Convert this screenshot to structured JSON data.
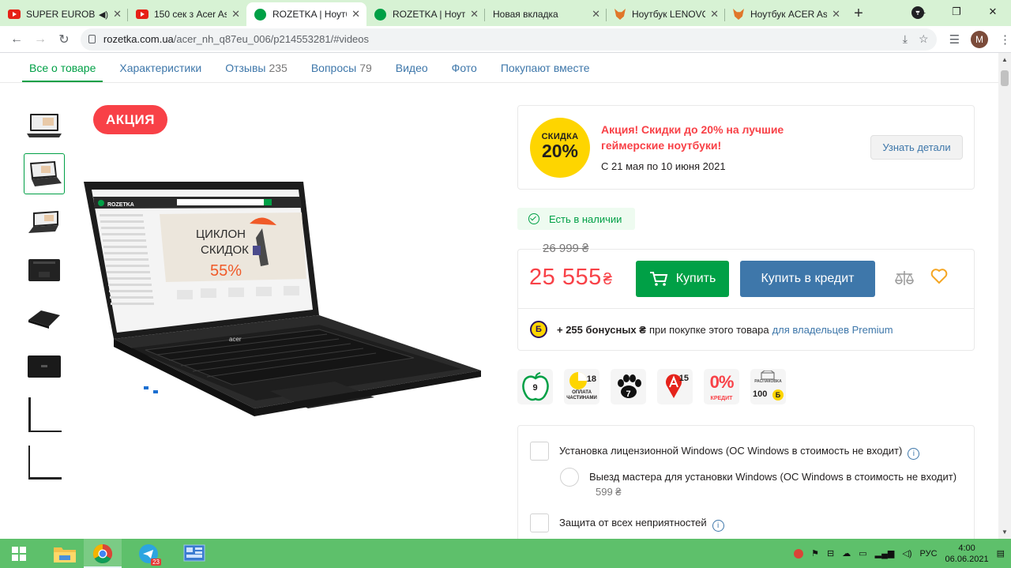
{
  "browser": {
    "tabs": [
      {
        "title": "SUPER EUROB",
        "favicon": "youtube-icon",
        "audio": true,
        "active": false
      },
      {
        "title": "150 сек з Acer Asp",
        "favicon": "youtube-icon",
        "audio": false,
        "active": false
      },
      {
        "title": "ROZETKA | Ноутбу",
        "favicon": "rozetka-icon",
        "audio": false,
        "active": true
      },
      {
        "title": "ROZETKA | Ноутбу",
        "favicon": "rozetka-icon",
        "audio": false,
        "active": false
      },
      {
        "title": "Новая вкладка",
        "favicon": "none",
        "audio": false,
        "active": false
      },
      {
        "title": "Ноутбук LENOVO",
        "favicon": "fox-icon",
        "audio": false,
        "active": false
      },
      {
        "title": "Ноутбук ACER As",
        "favicon": "fox-icon",
        "audio": false,
        "active": false
      }
    ],
    "url_host": "rozetka.com.ua",
    "url_path": "/acer_nh_q87eu_006/p214553281/#videos",
    "profile_initial": "M"
  },
  "product_tabs": [
    {
      "label": "Все о товаре",
      "count": "",
      "active": true
    },
    {
      "label": "Характеристики",
      "count": "",
      "active": false
    },
    {
      "label": "Отзывы",
      "count": "235",
      "active": false
    },
    {
      "label": "Вопросы",
      "count": "79",
      "active": false
    },
    {
      "label": "Видео",
      "count": "",
      "active": false
    },
    {
      "label": "Фото",
      "count": "",
      "active": false
    },
    {
      "label": "Покупают вместе",
      "count": "",
      "active": false
    }
  ],
  "sale_badge": "АКЦИЯ",
  "screen_ad": {
    "line1": "ЦИКЛОН",
    "line2": "СКИДОК",
    "percent": "55%",
    "brand": "ROZETKA",
    "logo": "acer"
  },
  "promo": {
    "circle_label": "СКИДКА",
    "circle_value": "20%",
    "title": "Акция! Скидки до 20% на лучшие геймерские ноутбуки!",
    "dates": "С 21 мая по 10 июня 2021",
    "button": "Узнать детали"
  },
  "stock_status": "Есть в наличии",
  "price": {
    "old": "26 999 ₴",
    "current": "25 555",
    "currency": "₴",
    "buy_label": "Купить",
    "credit_label": "Купить в кредит"
  },
  "bonus": {
    "icon_letter": "Б",
    "amount": "+ 255 бонусных ₴",
    "text": "при покупке этого товара",
    "link": "для владельцев Premium"
  },
  "badges": [
    {
      "name": "apple-badge",
      "value": "9"
    },
    {
      "name": "installments-badge",
      "value": "18",
      "caption": "ОПЛАТА ЧАСТИНАМИ"
    },
    {
      "name": "paw-badge",
      "value": "7"
    },
    {
      "name": "a-bank-badge",
      "value": "15"
    },
    {
      "name": "zero-credit-badge",
      "value": "0%",
      "caption": "КРЕДИТ"
    },
    {
      "name": "unboxing-badge",
      "value": "100",
      "caption": "РАСПАКОВКА",
      "currency": "Б"
    }
  ],
  "services": [
    {
      "type": "checkbox",
      "label": "Установка лицензионной Windows (ОС Windows в стоимость не входит)",
      "info": true
    },
    {
      "type": "radio",
      "label": "Выезд мастера для установки Windows (ОС Windows в стоимость не входит)",
      "price": "599 ₴"
    },
    {
      "type": "checkbox",
      "label": "Защита от всех неприятностей",
      "info": true
    }
  ],
  "taskbar": {
    "apps": [
      "file-explorer",
      "chrome",
      "telegram",
      "control-panel"
    ],
    "telegram_badge": "23",
    "language": "РУС",
    "time": "4:00",
    "date": "06.06.2021"
  },
  "colors": {
    "green": "#00a046",
    "blue": "#3e77aa",
    "red": "#f84147",
    "yellow": "#fed500"
  }
}
